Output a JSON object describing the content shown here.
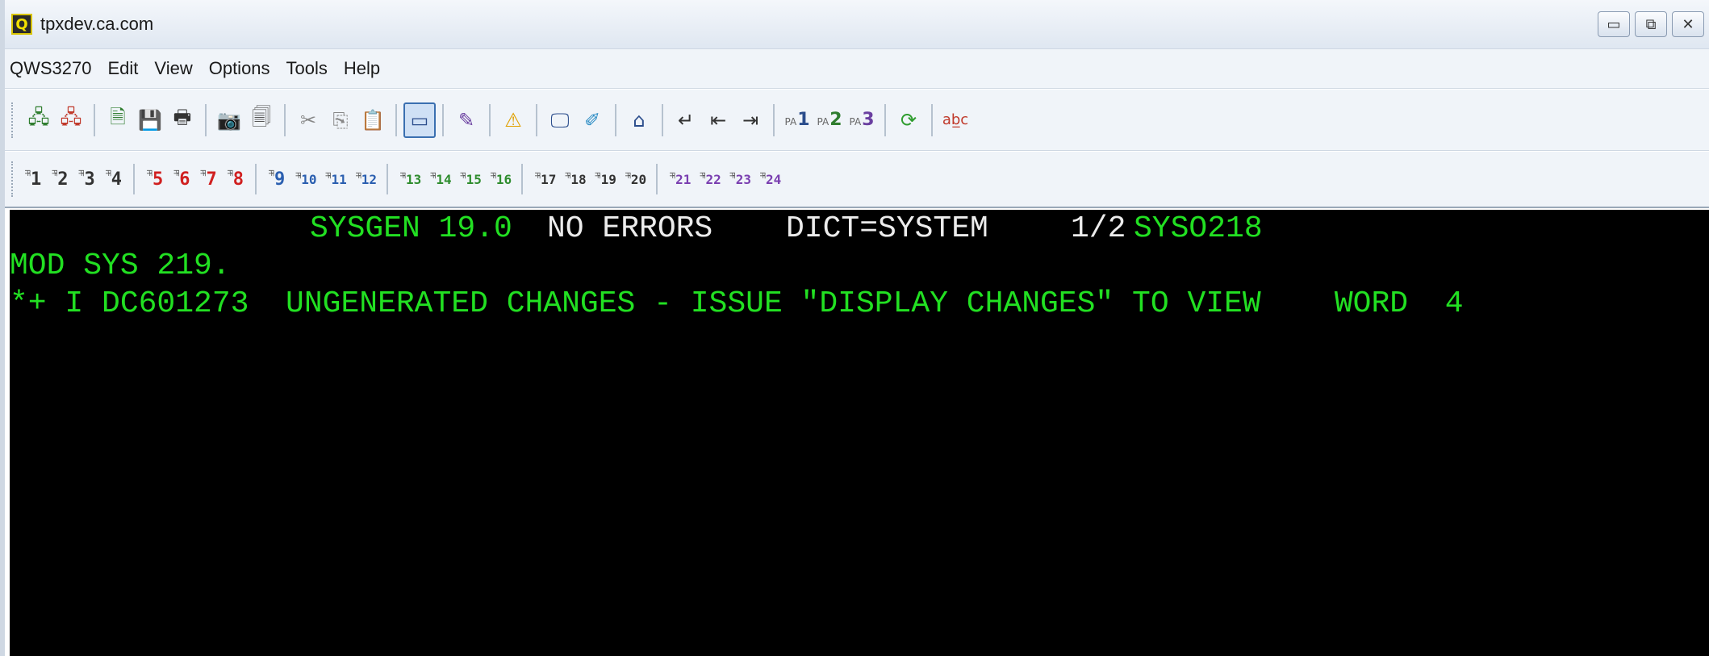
{
  "window": {
    "title": "tpxdev.ca.com"
  },
  "menu": [
    "QWS3270",
    "Edit",
    "View",
    "Options",
    "Tools",
    "Help"
  ],
  "toolbar_icons": [
    {
      "name": "connect-icon",
      "glyph": "🖧",
      "color": "#2f7d2f"
    },
    {
      "name": "disconnect-icon",
      "glyph": "🖧",
      "color": "#c0392b"
    },
    {
      "name": "sep"
    },
    {
      "name": "new-session-icon",
      "glyph": "🗎",
      "color": "#2f7d2f"
    },
    {
      "name": "save-session-icon",
      "glyph": "💾",
      "color": "#2b4d8c"
    },
    {
      "name": "print-icon",
      "glyph": "🖶",
      "color": "#333333"
    },
    {
      "name": "sep"
    },
    {
      "name": "camera-icon",
      "glyph": "📷",
      "color": "#333333"
    },
    {
      "name": "screen-capture-icon",
      "glyph": "🗐",
      "color": "#555555"
    },
    {
      "name": "sep"
    },
    {
      "name": "cut-icon",
      "glyph": "✂",
      "color": "#888888"
    },
    {
      "name": "copy-icon",
      "glyph": "⎘",
      "color": "#888888"
    },
    {
      "name": "paste-icon",
      "glyph": "📋",
      "color": "#a07030"
    },
    {
      "name": "sep"
    },
    {
      "name": "keypad-icon",
      "glyph": "▭",
      "color": "#2b4d8c",
      "selected": true
    },
    {
      "name": "sep"
    },
    {
      "name": "edit-icon",
      "glyph": "✎",
      "color": "#6a3fa0"
    },
    {
      "name": "sep"
    },
    {
      "name": "warning-icon",
      "glyph": "⚠",
      "color": "#e0a000"
    },
    {
      "name": "sep"
    },
    {
      "name": "display-icon",
      "glyph": "🖵",
      "color": "#2b4d8c"
    },
    {
      "name": "pin-icon",
      "glyph": "✐",
      "color": "#2b8cc4"
    },
    {
      "name": "sep"
    },
    {
      "name": "home-icon",
      "glyph": "⌂",
      "color": "#2b4d8c"
    },
    {
      "name": "sep"
    },
    {
      "name": "enter-icon",
      "glyph": "↵",
      "color": "#333333"
    },
    {
      "name": "backtab-icon",
      "glyph": "⇤",
      "color": "#333333"
    },
    {
      "name": "tab-icon",
      "glyph": "⇥",
      "color": "#333333"
    },
    {
      "name": "sep"
    },
    {
      "name": "pa1-icon",
      "glyph": "1",
      "color": "#2b4d8c",
      "pa": true
    },
    {
      "name": "pa2-icon",
      "glyph": "2",
      "color": "#2f7d2f",
      "pa": true
    },
    {
      "name": "pa3-icon",
      "glyph": "3",
      "color": "#6a3fa0",
      "pa": true
    },
    {
      "name": "sep"
    },
    {
      "name": "refresh-icon",
      "glyph": "⟳",
      "color": "#2f9d2f"
    },
    {
      "name": "sep"
    },
    {
      "name": "spellcheck-icon",
      "glyph": "ab̲c",
      "color": "#c0392b"
    }
  ],
  "pfkeys": [
    {
      "n": "1",
      "color": "#333333"
    },
    {
      "n": "2",
      "color": "#333333"
    },
    {
      "n": "3",
      "color": "#333333"
    },
    {
      "n": "4",
      "color": "#333333"
    },
    {
      "sep": true
    },
    {
      "n": "5",
      "color": "#d02020"
    },
    {
      "n": "6",
      "color": "#d02020"
    },
    {
      "n": "7",
      "color": "#d02020"
    },
    {
      "n": "8",
      "color": "#d02020"
    },
    {
      "sep": true
    },
    {
      "n": "9",
      "color": "#2b5fb0"
    },
    {
      "n": "10",
      "color": "#2b5fb0"
    },
    {
      "n": "11",
      "color": "#2b5fb0"
    },
    {
      "n": "12",
      "color": "#2b5fb0"
    },
    {
      "sep": true
    },
    {
      "n": "13",
      "color": "#2f8d2f"
    },
    {
      "n": "14",
      "color": "#2f8d2f"
    },
    {
      "n": "15",
      "color": "#2f8d2f"
    },
    {
      "n": "16",
      "color": "#2f8d2f"
    },
    {
      "sep": true
    },
    {
      "n": "17",
      "color": "#333333"
    },
    {
      "n": "18",
      "color": "#333333"
    },
    {
      "n": "19",
      "color": "#333333"
    },
    {
      "n": "20",
      "color": "#333333"
    },
    {
      "sep": true
    },
    {
      "n": "21",
      "color": "#7a3fb0"
    },
    {
      "n": "22",
      "color": "#7a3fb0"
    },
    {
      "n": "23",
      "color": "#7a3fb0"
    },
    {
      "n": "24",
      "color": "#7a3fb0"
    }
  ],
  "terminal": {
    "colors": {
      "green": "#22e022",
      "white": "#ececec",
      "background": "#000000"
    },
    "line1": {
      "product": "SYSGEN 19.0",
      "status": "NO ERRORS",
      "dict": "DICT=SYSTEM",
      "page": "1/2",
      "panel": "SYSO218"
    },
    "line2": "MOD SYS 219.",
    "line3": "*+ I DC601273  UNGENERATED CHANGES - ISSUE \"DISPLAY CHANGES\" TO VIEW    WORD  4"
  }
}
